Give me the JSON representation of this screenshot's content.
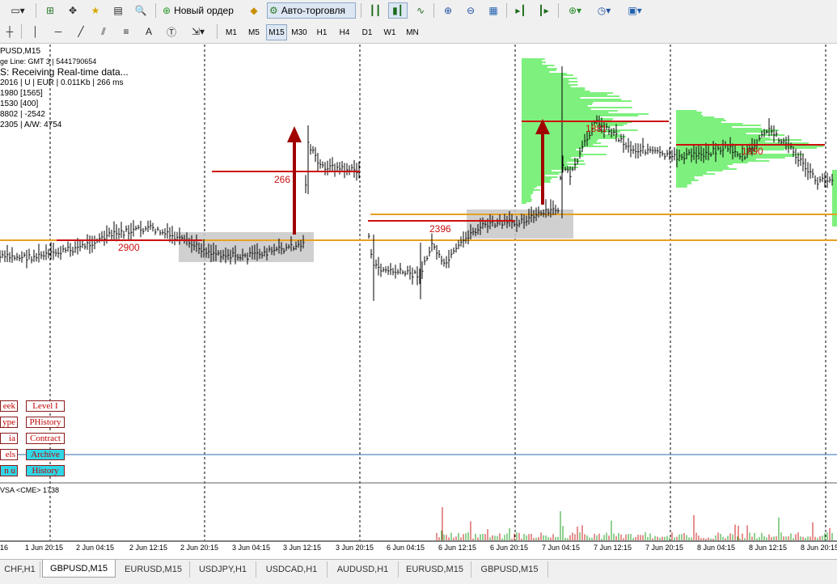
{
  "toolbar": {
    "new_order_label": "Новый ордер",
    "auto_trading_label": "Авто-торговля",
    "timeframes": [
      "M1",
      "M5",
      "M15",
      "M30",
      "H1",
      "H4",
      "D1",
      "W1",
      "MN"
    ],
    "active_timeframe": "M15"
  },
  "info_lines": [
    "PUSD,M15",
    "ge Line: GMT 3 | 5441790654",
    "S:  Receiving Real-time data...",
    "2016 | U | EUR | 0.011Kb | 266 ms",
    "1980  [1565]",
    "1530  [400]",
    "8802 | -2542",
    "2305 | A/W: 4754"
  ],
  "level_labels": [
    "266",
    "2900",
    "2396",
    "1881",
    "1890"
  ],
  "panel_buttons": {
    "left": [
      "eek",
      "ype",
      "ia",
      "els",
      "n u"
    ],
    "right": [
      "Level I",
      "PHistory",
      "Contract",
      "Archive",
      "History"
    ]
  },
  "indicator_label": "VSA <CME> 1738",
  "time_labels": [
    "16",
    "1 Jun 20:15",
    "2 Jun 04:15",
    "2 Jun 12:15",
    "2 Jun 20:15",
    "3 Jun 04:15",
    "3 Jun 12:15",
    "3 Jun 20:15",
    "6 Jun 04:15",
    "6 Jun 12:15",
    "6 Jun 20:15",
    "7 Jun 04:15",
    "7 Jun 12:15",
    "7 Jun 20:15",
    "8 Jun 04:15",
    "8 Jun 12:15",
    "8 Jun 20:15"
  ],
  "tabs": [
    "CHF,H1",
    "GBPUSD,M15",
    "EURUSD,M15",
    "USDJPY,H1",
    "USDCAD,H1",
    "AUDUSD,H1",
    "EURUSD,M15",
    "GBPUSD,M15"
  ],
  "active_tab": "GBPUSD,M15",
  "colors": {
    "level_line": "#cc1010",
    "orange_line": "#e8a020",
    "profile_green": "#7ef07e",
    "zone_gray": "#c8c8c8",
    "arrow": "#a00000",
    "cyan_button": "#2fd6e6"
  }
}
